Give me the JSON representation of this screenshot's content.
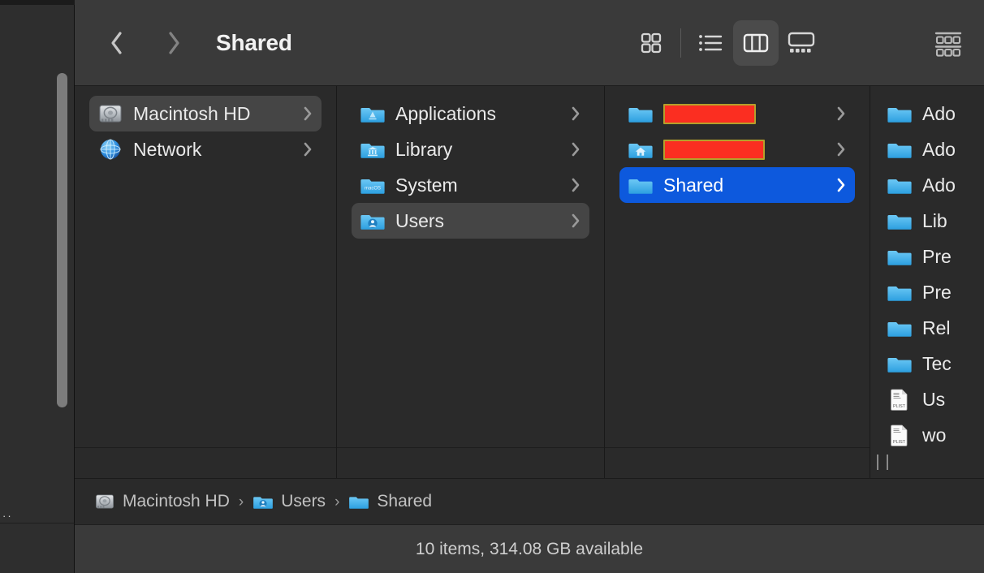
{
  "window": {
    "title": "Shared",
    "back_label": "Back",
    "forward_label": "Forward"
  },
  "toolbar": {
    "view_modes": [
      {
        "name": "icon-view",
        "label": "Icon View",
        "active": false
      },
      {
        "name": "list-view",
        "label": "List View",
        "active": false
      },
      {
        "name": "column-view",
        "label": "Column View",
        "active": true
      },
      {
        "name": "gallery-view",
        "label": "Gallery View",
        "active": false
      }
    ],
    "group_label": "Group",
    "accent_selection": "#0d59dd",
    "active_button_bg": "#4b4b4b"
  },
  "columns": [
    {
      "name": "devices-column",
      "items": [
        {
          "label": "Macintosh HD",
          "icon": "hard-drive-icon",
          "state": "selected-inactive",
          "disclosure": true
        },
        {
          "label": "Network",
          "icon": "network-globe-icon",
          "state": "normal",
          "disclosure": true
        }
      ]
    },
    {
      "name": "root-column",
      "items": [
        {
          "label": "Applications",
          "icon": "applications-folder-icon",
          "state": "normal",
          "disclosure": true
        },
        {
          "label": "Library",
          "icon": "library-folder-icon",
          "state": "normal",
          "disclosure": true
        },
        {
          "label": "System",
          "icon": "system-folder-icon",
          "state": "normal",
          "disclosure": true
        },
        {
          "label": "Users",
          "icon": "users-folder-icon",
          "state": "selected-inactive",
          "disclosure": true
        }
      ]
    },
    {
      "name": "users-column",
      "items": [
        {
          "label": "",
          "icon": "folder-icon",
          "state": "normal",
          "disclosure": true,
          "redacted": "wide"
        },
        {
          "label": "",
          "icon": "home-folder-icon",
          "state": "normal",
          "disclosure": true,
          "redacted": "wider"
        },
        {
          "label": "Shared",
          "icon": "folder-icon",
          "state": "selected-active",
          "disclosure": true
        }
      ]
    },
    {
      "name": "shared-column",
      "items": [
        {
          "label": "Ado",
          "icon": "folder-icon",
          "state": "normal",
          "disclosure": false
        },
        {
          "label": "Ado",
          "icon": "folder-icon",
          "state": "normal",
          "disclosure": false
        },
        {
          "label": "Ado",
          "icon": "folder-icon",
          "state": "normal",
          "disclosure": false
        },
        {
          "label": "Lib",
          "icon": "folder-icon",
          "state": "normal",
          "disclosure": false
        },
        {
          "label": "Pre",
          "icon": "folder-icon",
          "state": "normal",
          "disclosure": false
        },
        {
          "label": "Pre",
          "icon": "folder-icon",
          "state": "normal",
          "disclosure": false
        },
        {
          "label": "Rel",
          "icon": "folder-icon",
          "state": "normal",
          "disclosure": false
        },
        {
          "label": "Tec",
          "icon": "folder-icon",
          "state": "normal",
          "disclosure": false
        },
        {
          "label": "Us",
          "icon": "plist-file-icon",
          "state": "normal",
          "disclosure": false
        },
        {
          "label": "wo",
          "icon": "plist-file-icon",
          "state": "normal",
          "disclosure": false
        }
      ]
    }
  ],
  "redaction": {
    "fill": "#fb2e21",
    "border": "#b5a02b"
  },
  "pathbar": {
    "crumbs": [
      {
        "label": "Macintosh HD",
        "icon": "hard-drive-icon"
      },
      {
        "label": "Users",
        "icon": "users-folder-icon"
      },
      {
        "label": "Shared",
        "icon": "folder-icon"
      }
    ],
    "separator": "›"
  },
  "statusbar": {
    "text": "10 items, 314.08 GB available"
  },
  "behind": {
    "dots": "··"
  }
}
